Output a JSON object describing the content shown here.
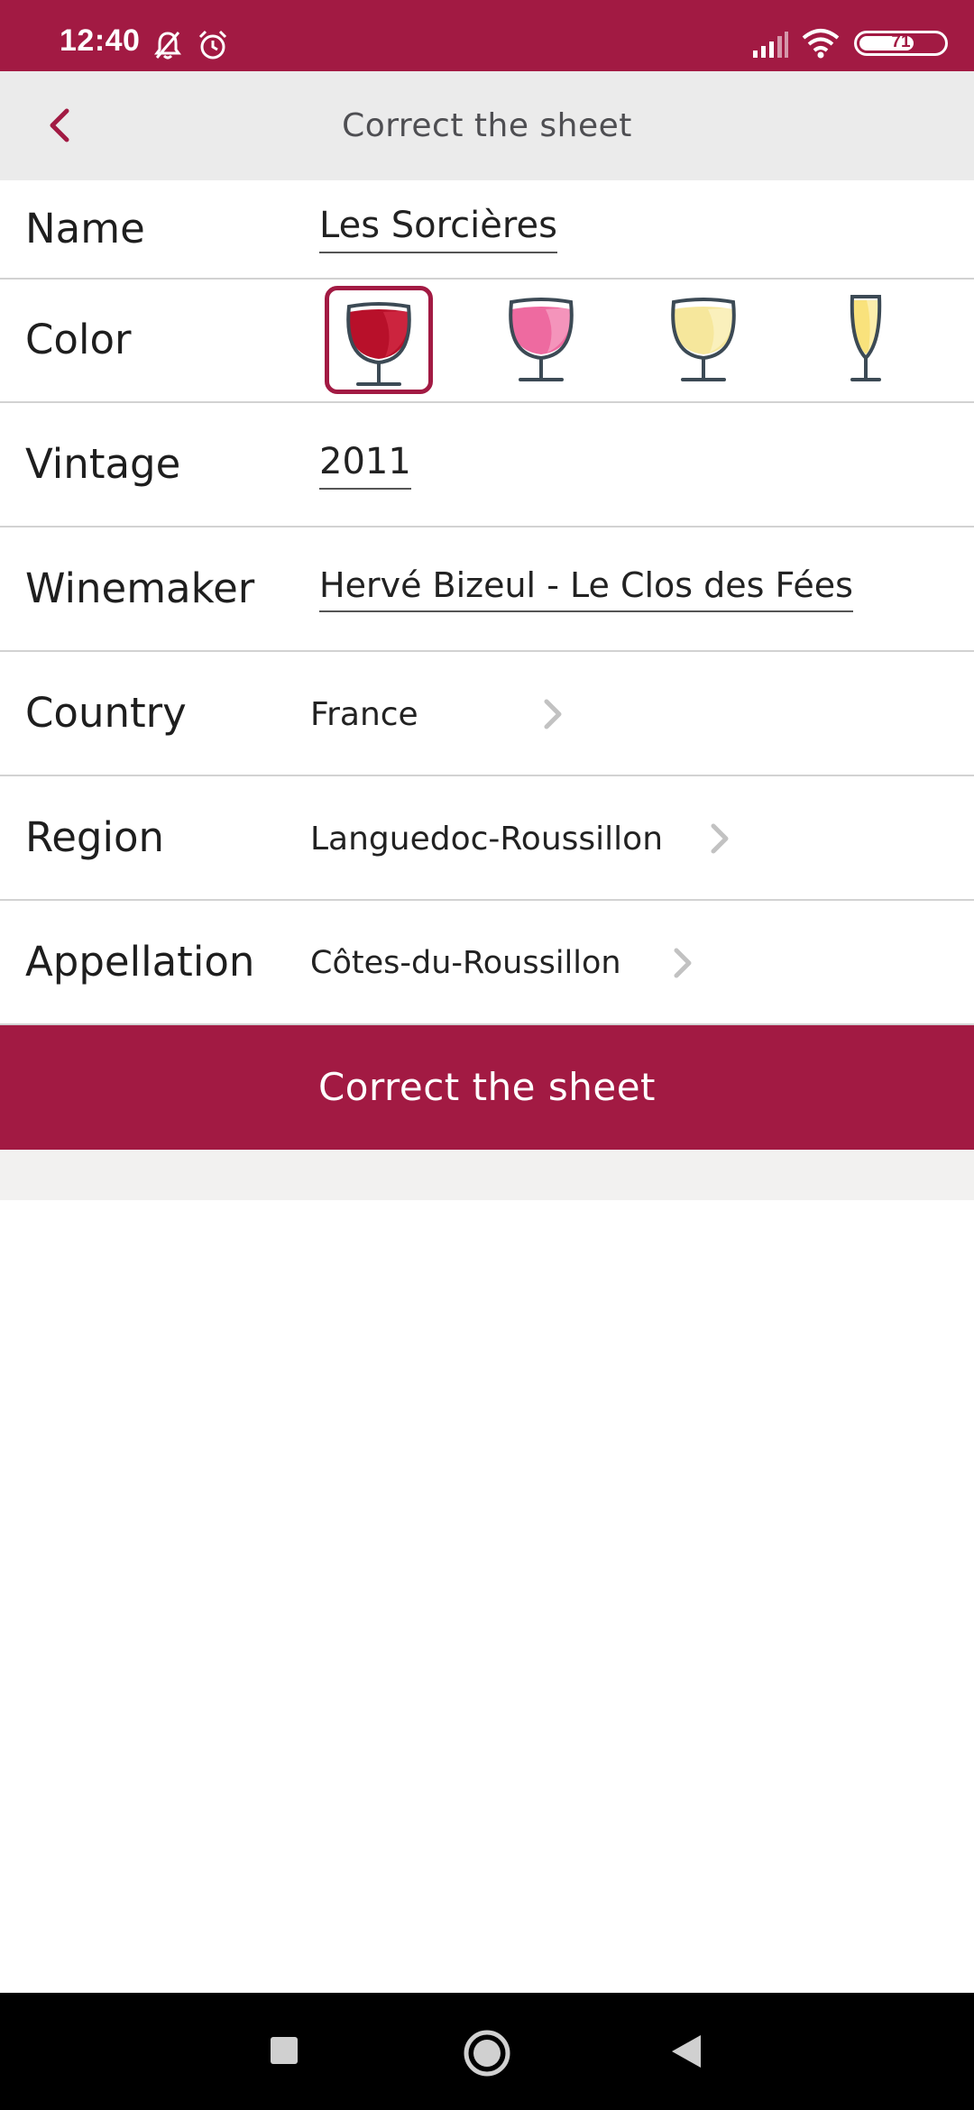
{
  "status_bar": {
    "time": "12:40",
    "battery": "71",
    "icons": [
      "bell-off-icon",
      "alarm-icon",
      "signal-icon",
      "wifi-icon",
      "battery-icon"
    ]
  },
  "header": {
    "title": "Correct the sheet",
    "back_icon": "chevron-left-icon"
  },
  "form": {
    "name": {
      "label": "Name",
      "value": "Les Sorcières"
    },
    "color": {
      "label": "Color",
      "options": [
        "red-wine-glass-icon",
        "rose-wine-glass-icon",
        "white-wine-glass-icon",
        "sparkling-wine-glass-icon"
      ],
      "selected": "red-wine-glass-icon"
    },
    "vintage": {
      "label": "Vintage",
      "value": "2011"
    },
    "winemaker": {
      "label": "Winemaker",
      "value": "Hervé Bizeul - Le Clos des Fées"
    },
    "country": {
      "label": "Country",
      "value": "France"
    },
    "region": {
      "label": "Region",
      "value": "Languedoc-Roussillon"
    },
    "appellation": {
      "label": "Appellation",
      "value": "Côtes-du-Roussillon"
    }
  },
  "submit_label": "Correct the sheet",
  "colors": {
    "brand": "#a21a43",
    "appbar_bg": "#ebebeb",
    "divider": "#d2d2d2",
    "red_wine": "#b8102a",
    "rose_wine": "#ee6aa0",
    "white_wine": "#f6e79c",
    "sparkling_wine": "#f9e27c"
  },
  "nav_bar": {
    "icons": [
      "recents-square-icon",
      "home-circle-icon",
      "back-triangle-icon"
    ]
  }
}
